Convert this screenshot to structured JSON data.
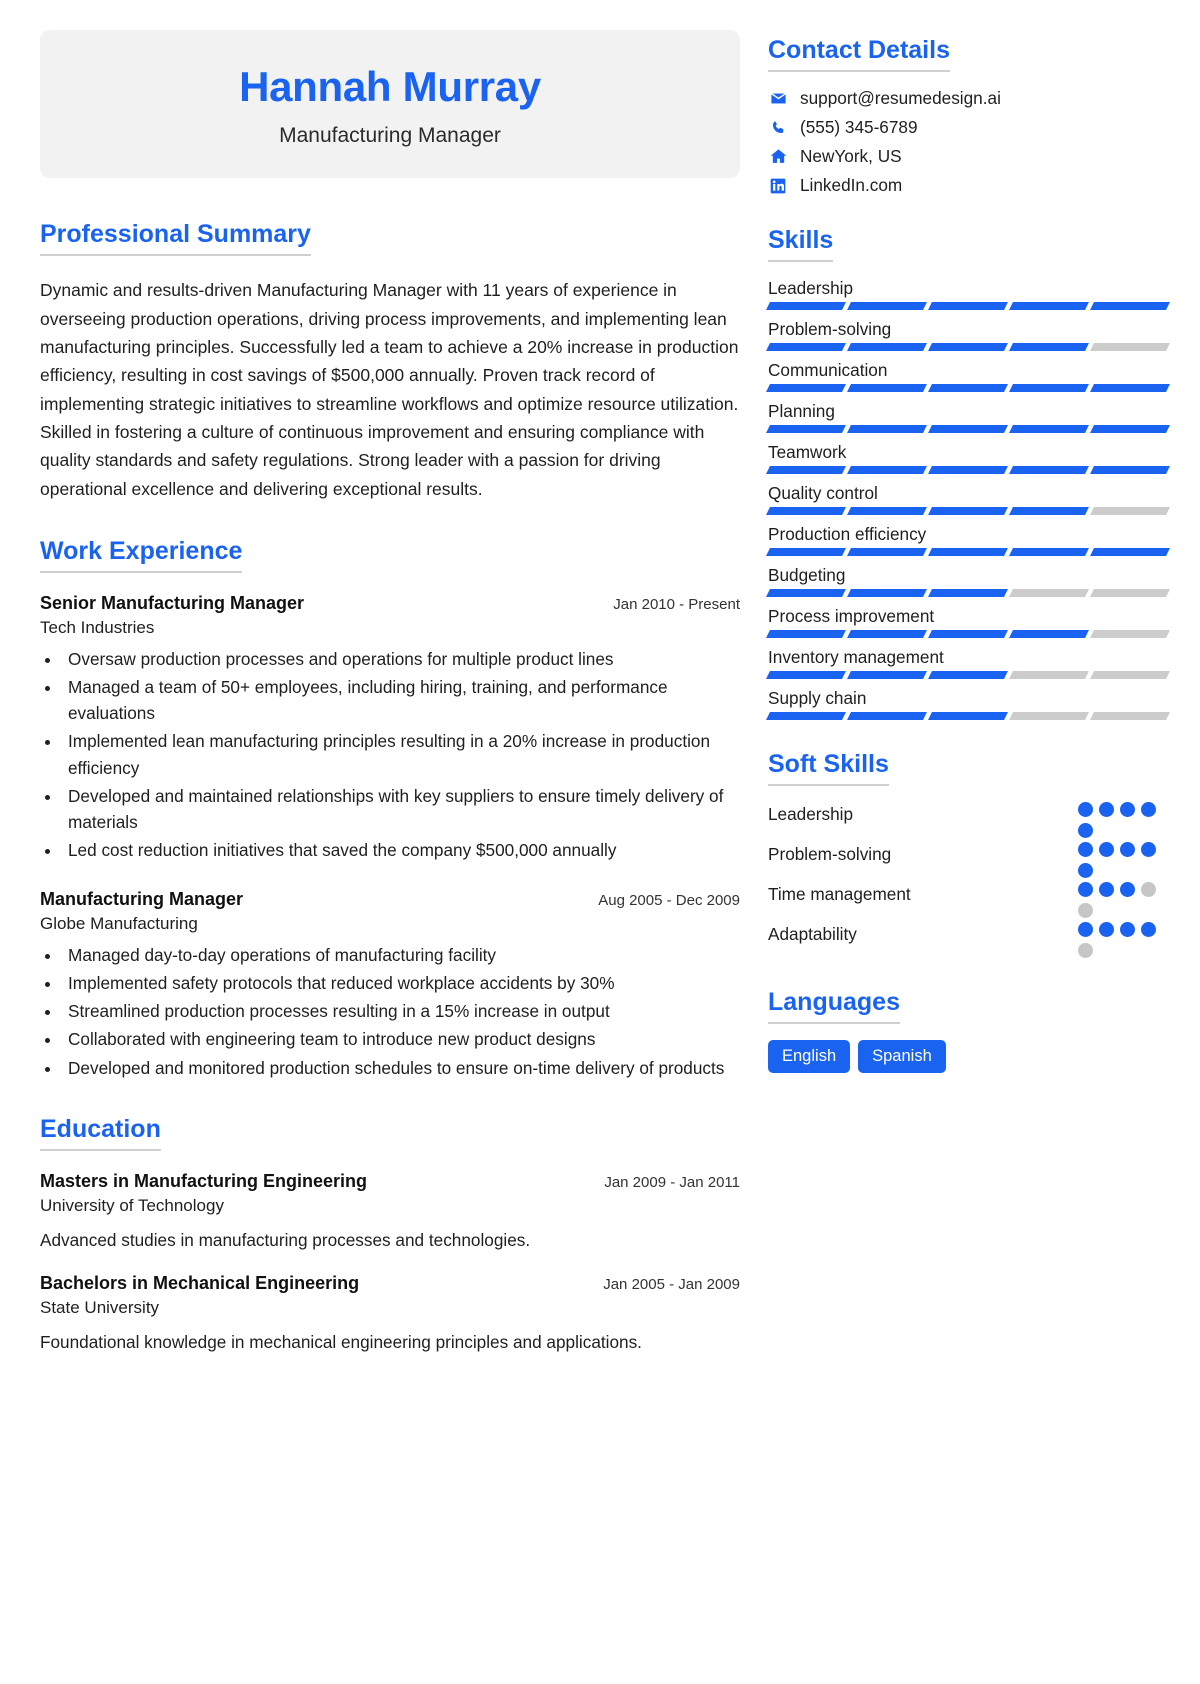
{
  "header": {
    "name": "Hannah Murray",
    "role": "Manufacturing Manager"
  },
  "summary": {
    "heading": "Professional Summary",
    "text": "Dynamic and results-driven Manufacturing Manager with 11 years of experience in overseeing production operations, driving process improvements, and implementing lean manufacturing principles. Successfully led a team to achieve a 20% increase in production efficiency, resulting in cost savings of $500,000 annually. Proven track record of implementing strategic initiatives to streamline workflows and optimize resource utilization. Skilled in fostering a culture of continuous improvement and ensuring compliance with quality standards and safety regulations. Strong leader with a passion for driving operational excellence and delivering exceptional results."
  },
  "work": {
    "heading": "Work Experience",
    "jobs": [
      {
        "title": "Senior Manufacturing Manager",
        "date": "Jan 2010 - Present",
        "org": "Tech Industries",
        "bullets": [
          "Oversaw production processes and operations for multiple product lines",
          "Managed a team of 50+ employees, including hiring, training, and performance evaluations",
          "Implemented lean manufacturing principles resulting in a 20% increase in production efficiency",
          "Developed and maintained relationships with key suppliers to ensure timely delivery of materials",
          "Led cost reduction initiatives that saved the company $500,000 annually"
        ]
      },
      {
        "title": "Manufacturing Manager",
        "date": "Aug 2005 - Dec 2009",
        "org": "Globe Manufacturing",
        "bullets": [
          "Managed day-to-day operations of manufacturing facility",
          "Implemented safety protocols that reduced workplace accidents by 30%",
          "Streamlined production processes resulting in a 15% increase in output",
          "Collaborated with engineering team to introduce new product designs",
          "Developed and monitored production schedules to ensure on-time delivery of products"
        ]
      }
    ]
  },
  "education": {
    "heading": "Education",
    "items": [
      {
        "degree": "Masters in Manufacturing Engineering",
        "date": "Jan 2009 - Jan 2011",
        "school": "University of Technology",
        "desc": "Advanced studies in manufacturing processes and technologies."
      },
      {
        "degree": "Bachelors in Mechanical Engineering",
        "date": "Jan 2005 - Jan 2009",
        "school": "State University",
        "desc": "Foundational knowledge in mechanical engineering principles and applications."
      }
    ]
  },
  "contact": {
    "heading": "Contact Details",
    "items": [
      {
        "icon": "envelope-icon",
        "value": "support@resumedesign.ai"
      },
      {
        "icon": "phone-icon",
        "value": "(555) 345-6789"
      },
      {
        "icon": "home-icon",
        "value": "NewYork, US"
      },
      {
        "icon": "linkedin-icon",
        "value": "LinkedIn.com"
      }
    ]
  },
  "skills": {
    "heading": "Skills",
    "total_segments": 5,
    "items": [
      {
        "name": "Leadership",
        "level": 5
      },
      {
        "name": "Problem-solving",
        "level": 4
      },
      {
        "name": "Communication",
        "level": 5
      },
      {
        "name": "Planning",
        "level": 5
      },
      {
        "name": "Teamwork",
        "level": 5
      },
      {
        "name": "Quality control",
        "level": 4
      },
      {
        "name": "Production efficiency",
        "level": 5
      },
      {
        "name": "Budgeting",
        "level": 3
      },
      {
        "name": "Process improvement",
        "level": 4
      },
      {
        "name": "Inventory management",
        "level": 3
      },
      {
        "name": "Supply chain",
        "level": 3
      }
    ]
  },
  "soft_skills": {
    "heading": "Soft Skills",
    "total_dots": 5,
    "items": [
      {
        "name": "Leadership",
        "level": 5
      },
      {
        "name": "Problem-solving",
        "level": 5
      },
      {
        "name": "Time management",
        "level": 3
      },
      {
        "name": "Adaptability",
        "level": 4
      }
    ]
  },
  "languages": {
    "heading": "Languages",
    "items": [
      "English",
      "Spanish"
    ]
  },
  "colors": {
    "accent": "#1a63f0",
    "muted": "#cccccc",
    "card_bg": "#f2f2f2"
  }
}
